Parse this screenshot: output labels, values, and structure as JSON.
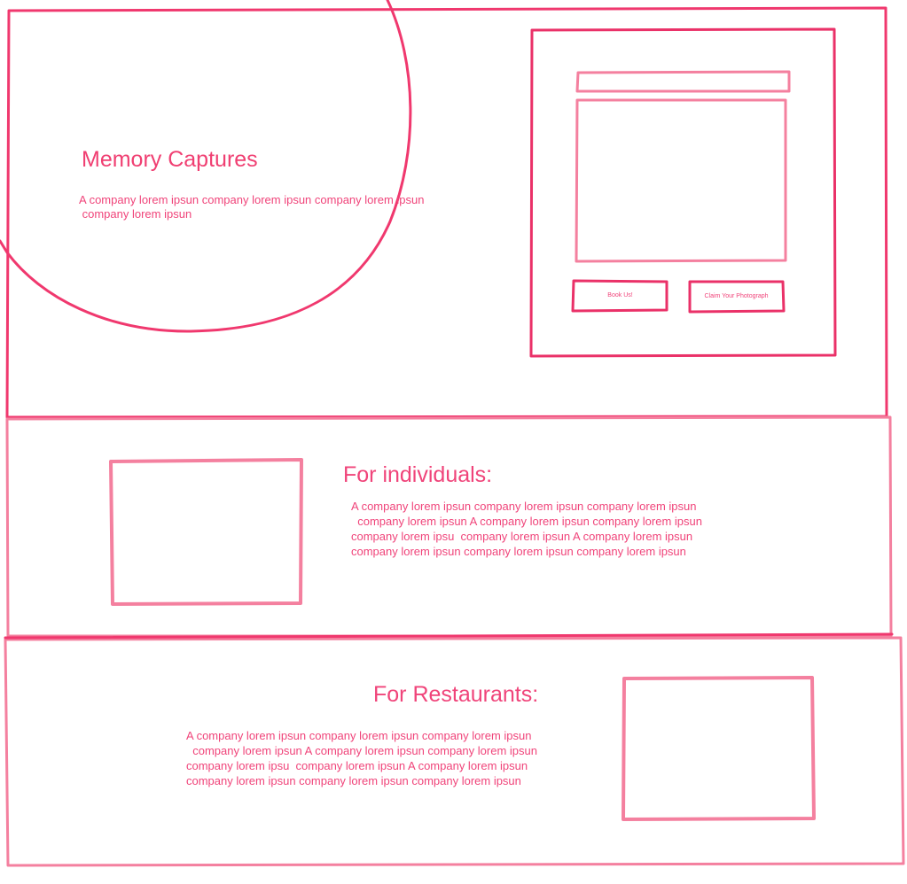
{
  "hero": {
    "title": "Memory Captures",
    "description_lines": [
      "A company lorem ipsun company lorem ipsun company lorem ipsun",
      " company lorem ipsun"
    ]
  },
  "booking_card": {
    "book_button_label": "Book Us!",
    "claim_button_label": "Claim Your Photograph"
  },
  "individuals": {
    "heading": "For individuals:",
    "body_lines": [
      "A company lorem ipsun company lorem ipsun company lorem ipsun",
      "  company lorem ipsun A company lorem ipsun company lorem ipsun",
      "company lorem ipsu  company lorem ipsun A company lorem ipsun",
      "company lorem ipsun company lorem ipsun company lorem ipsun"
    ]
  },
  "restaurants": {
    "heading": "For Restaurants:",
    "body_lines": [
      "A company lorem ipsun company lorem ipsun company lorem ipsun",
      "  company lorem ipsun A company lorem ipsun company lorem ipsun",
      "company lorem ipsu  company lorem ipsun A company lorem ipsun",
      "company lorem ipsun company lorem ipsun company lorem ipsun"
    ]
  },
  "colors": {
    "dark_stroke": "#f0386e",
    "light_stroke": "#f4809f",
    "text": "#f0447a"
  }
}
